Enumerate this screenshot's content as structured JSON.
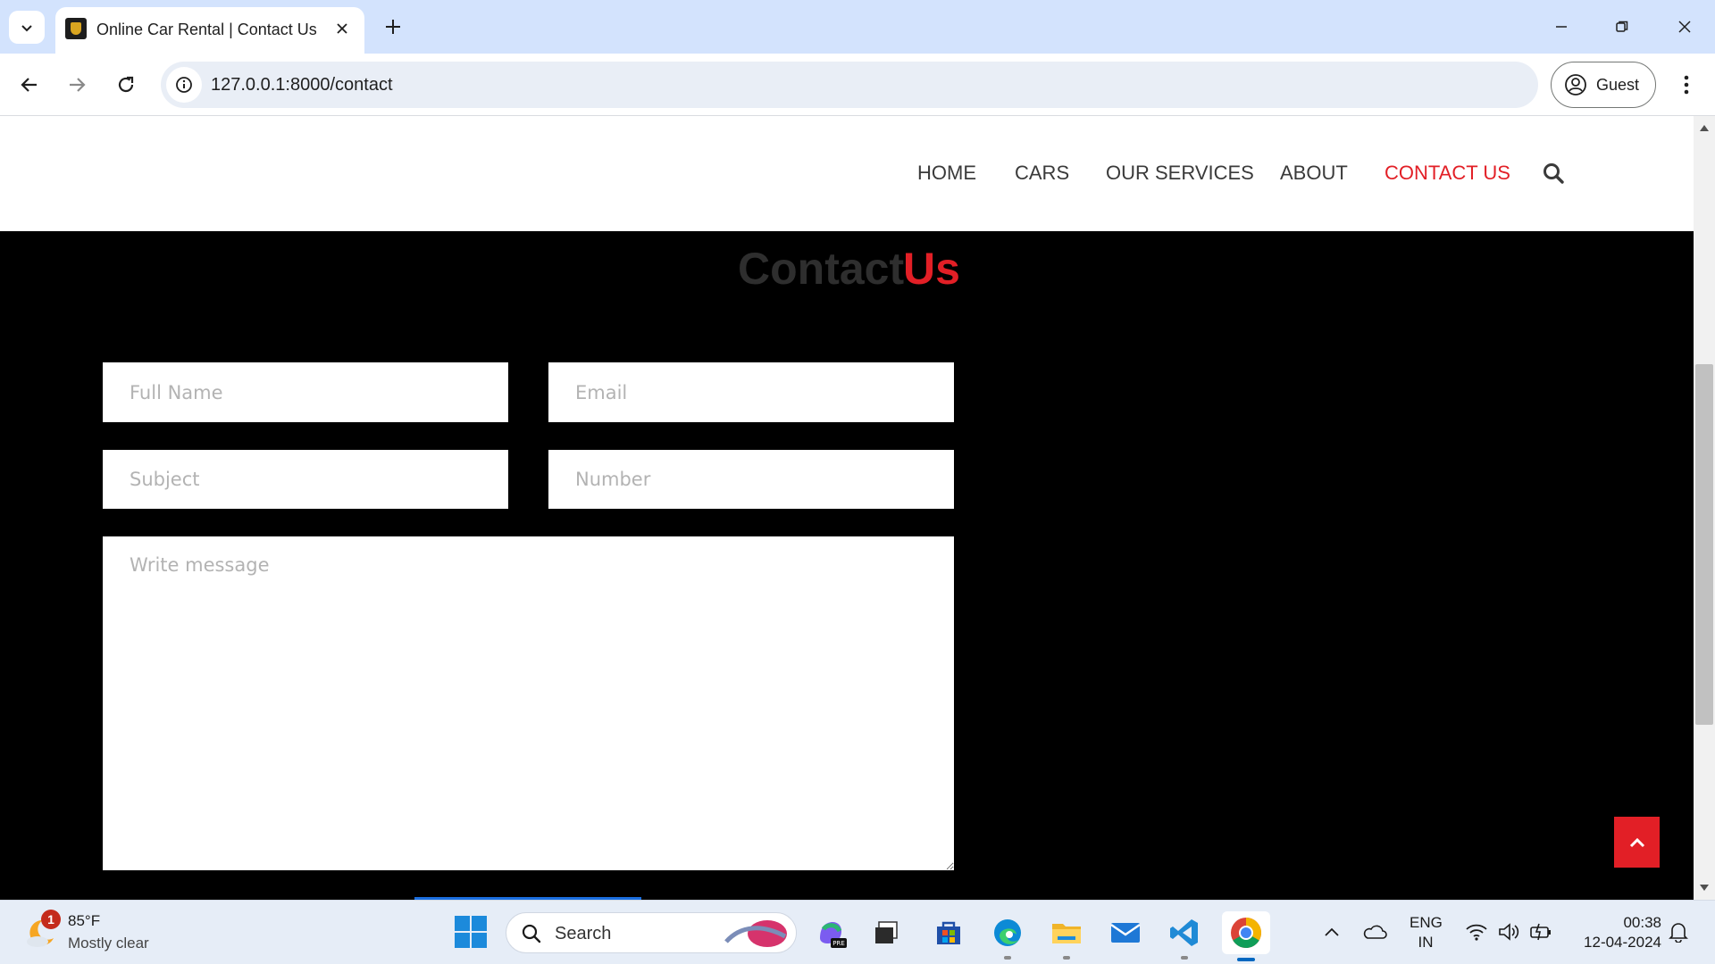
{
  "browser": {
    "tab_title": "Online Car Rental | Contact Us",
    "url": "127.0.0.1:8000/contact",
    "profile_label": "Guest"
  },
  "nav": {
    "items": [
      {
        "label": "HOME",
        "active": false
      },
      {
        "label": "CARS",
        "active": false
      },
      {
        "label": "OUR SERVICES",
        "active": false
      },
      {
        "label": "ABOUT",
        "active": false
      },
      {
        "label": "CONTACT US",
        "active": true
      }
    ],
    "accent_color": "#e21f26"
  },
  "contact": {
    "title_part1": "Contact",
    "title_part2": "Us",
    "fields": {
      "full_name_placeholder": "Full Name",
      "email_placeholder": "Email",
      "subject_placeholder": "Subject",
      "number_placeholder": "Number",
      "message_placeholder": "Write message"
    }
  },
  "taskbar": {
    "weather_badge": "1",
    "weather_temp": "85°F",
    "weather_desc": "Mostly clear",
    "search_label": "Search",
    "lang_line1": "ENG",
    "lang_line2": "IN",
    "time": "00:38",
    "date": "12-04-2024"
  }
}
